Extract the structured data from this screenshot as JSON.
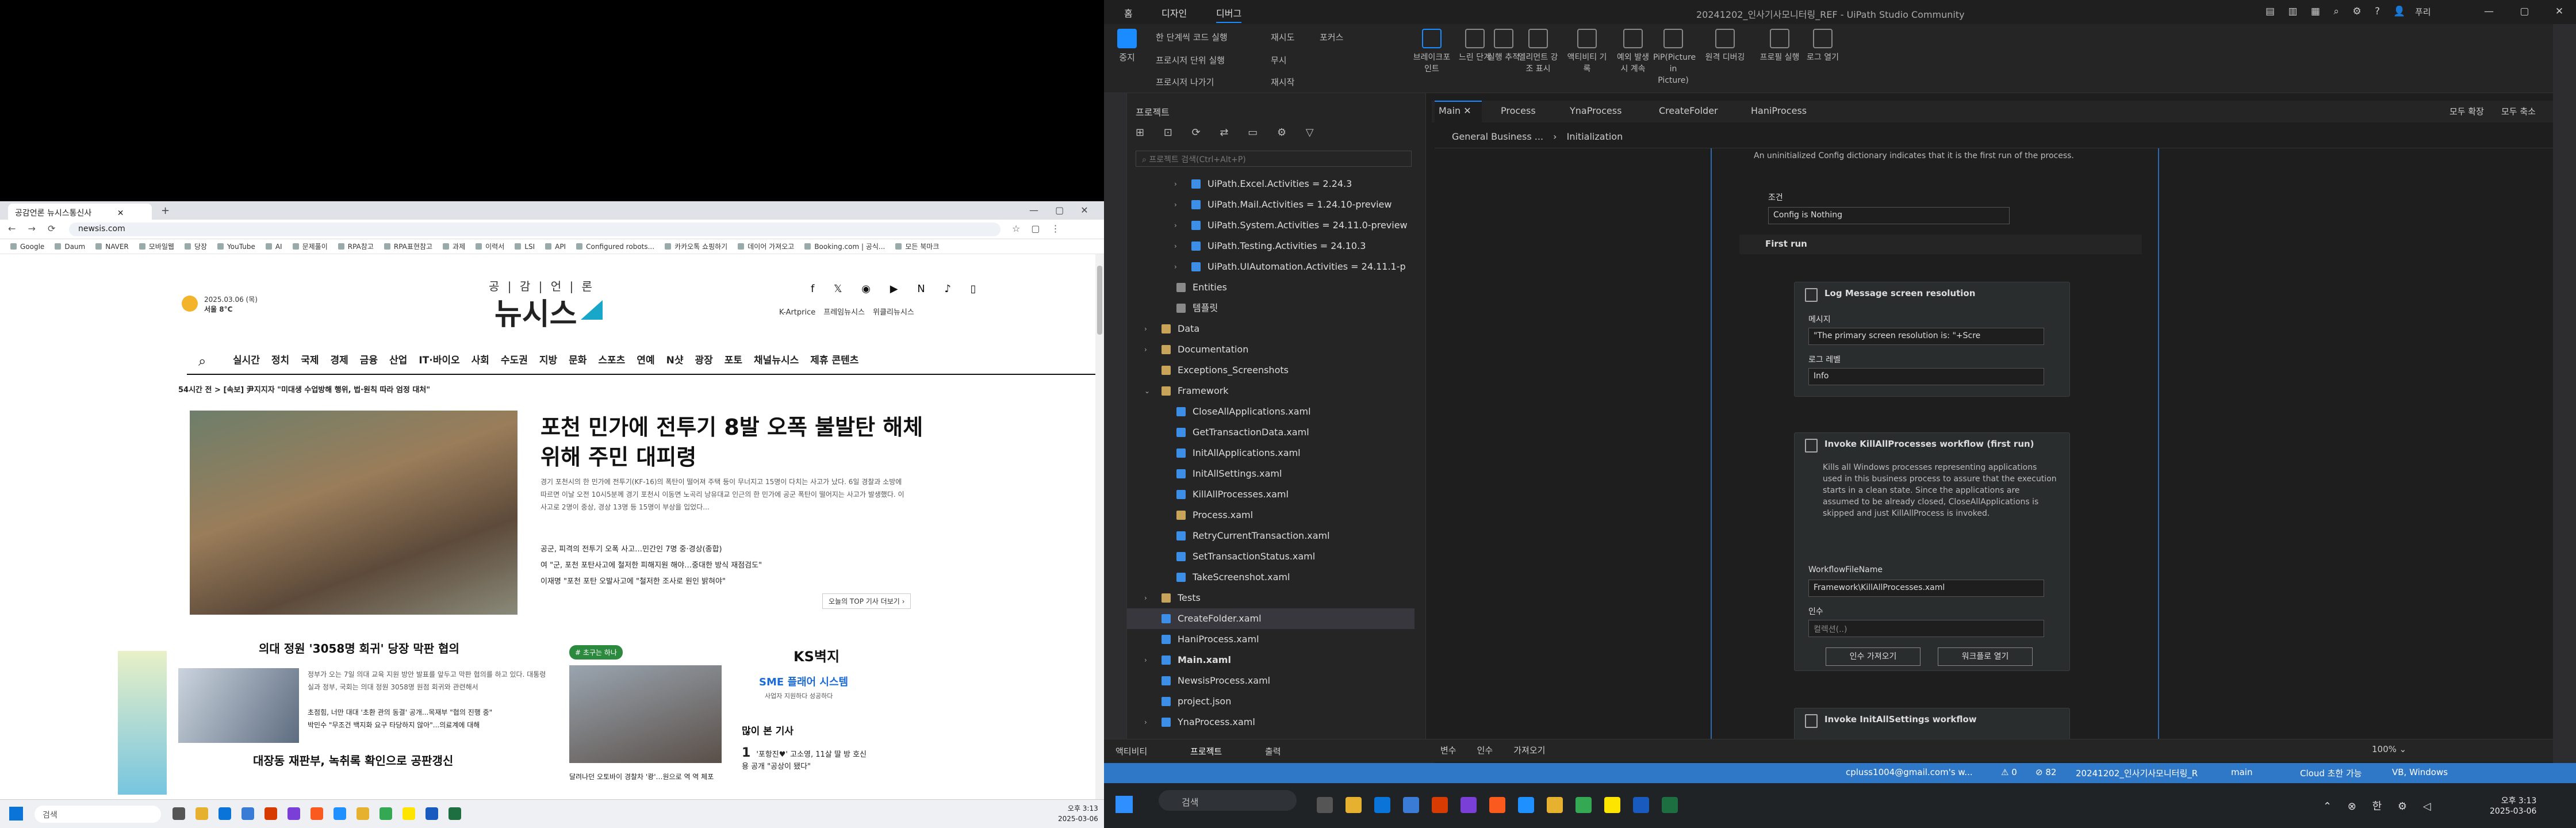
{
  "browser": {
    "tab_title": "공감언론 뉴시스통신사",
    "url": "newsis.com",
    "bookmarks": [
      "Google",
      "Daum",
      "NAVER",
      "모바일웹",
      "당장",
      "YouTube",
      "AI",
      "문제풀이",
      "RPA참고",
      "RPA표현참고",
      "과제",
      "이력서",
      "LSI",
      "API",
      "Configured robots...",
      "카카오톡 쇼핑하기",
      "데이어 가져오고",
      "Booking.com | 공식...",
      "모든 북마크"
    ],
    "site": {
      "logo_top": "공 | 감 | 언 | 론",
      "logo": "뉴시스",
      "weather_date": "2025.03.06 (목)",
      "weather_loc": "서울 8°C",
      "topnav": [
        "K-Artprice",
        "프레임뉴시스",
        "위클리뉴시스"
      ],
      "menu": [
        "실시간",
        "정치",
        "국제",
        "경제",
        "금융",
        "산업",
        "IT·바이오",
        "사회",
        "수도권",
        "지방",
        "문화",
        "스포츠",
        "연예",
        "N샷",
        "광장",
        "포토",
        "채널뉴시스",
        "제휴 콘텐츠"
      ],
      "ticker": "54시간 전 > [속보] 尹지지자 \"미대생 수업방해 행위, 법·원칙 따라 엄정 대처\"",
      "hero_title": "포천 민가에 전투기 8발 오폭 불발탄 해체 위해 주민 대피령",
      "hero_body": "경기 포천시의 한 민가에 전투기(KF-16)의 폭탄이 떨어져 주택 등이 무너지고 15명이 다치는 사고가 났다. 6일 경찰과 소방에 따르면 이날 오전 10시5분께 경기 포천시 이동면 노곡리 낭유대교 인근의 한 민가에 공군 폭탄이 떨어지는 사고가 발생했다. 이 사고로 2명이 중상, 경상 13명 등 15명이 부상을 입었다...",
      "hero_links": [
        "공군, 피격의 전투기 오폭 사고…민간인 7명 중·경상(종합)",
        "여 \"군, 포천 포탄사고에 철저한 피해지원 해야…중대한 방식 재점검도\"",
        "이재명 \"포천 포탄 오발사고에 \"철저한 조사로 원인 밝혀야\""
      ],
      "more": "오늘의 TOP 기사 더보기 ›",
      "sec1_title": "의대 정원 '3058명 회귀' 당장 막판 협의",
      "sec1_body": "정부가 오는 7일 의대 교육 지원 방안 발표를 앞두고 막판 협의를 하고 있다. 대통령실과 정부, 국회는 의대 정원 3058명 원점 회귀와 관련해서",
      "sec1_links": [
        "초점힘, 너만 대대 '초환 관의 동결' 공개...목재부 \"협의 진행 중\"",
        "박민수 \"무조건 백지화 요구 타당하지 않아\"...의료계에 대해"
      ],
      "sec2_title": "대장동 재판부, 녹취록 확인으로 공판갱신",
      "tag": "# 초구는 하나",
      "img3_caption": "달려나던 오토바이 경찰차 '쾅'…원으로 역 역 체포",
      "ks": "KS벽지",
      "ad": "SME 플래어 시스템",
      "ad_sub": "사업자 지원하다 성공하다",
      "popular": "많이 본 기사",
      "pop1_num": "1",
      "pop1": "'포항진♥' 고소영, 11살 딸 방 호신용 공개 \"공상이 됐다\""
    }
  },
  "taskbar_left": {
    "search": "검색",
    "time": "오후 3:13",
    "date": "2025-03-06"
  },
  "studio": {
    "title": "20241202_인사기사모니터링_REF - UiPath Studio Community",
    "ribbon_tabs": [
      "홈",
      "디자인",
      "디버그"
    ],
    "ribbon_stop": "중지",
    "ribbon_small": [
      [
        "한 단계씩 코드 실행",
        "재시도",
        "포커스"
      ],
      [
        "프로시저 단위 실행",
        "무시"
      ],
      [
        "프로시저 나가기",
        "재시작"
      ]
    ],
    "ribbon_big": [
      "브레이크포인트",
      "느린 단계",
      "실행 추적",
      "엘리먼트 강조 표시",
      "액티비티 기록",
      "예외 발생 시 계속",
      "PiP(Picture in Picture)",
      "원격 디버깅",
      "프로필 실행",
      "로그 열기"
    ],
    "project_header": "프로젝트",
    "project_search": "프로젝트 검색(Ctrl+Alt+P)",
    "tree": [
      {
        "label": "UiPath.Excel.Activities = 2.24.3",
        "indent": 2,
        "chev": "›",
        "color": "#3c8ee6"
      },
      {
        "label": "UiPath.Mail.Activities = 1.24.10-preview",
        "indent": 2,
        "chev": "›",
        "color": "#3c8ee6"
      },
      {
        "label": "UiPath.System.Activities = 24.11.0-preview",
        "indent": 2,
        "chev": "›",
        "color": "#3c8ee6"
      },
      {
        "label": "UiPath.Testing.Activities = 24.10.3",
        "indent": 2,
        "chev": "›",
        "color": "#3c8ee6"
      },
      {
        "label": "UiPath.UIAutomation.Activities = 24.11.1-p",
        "indent": 2,
        "chev": "›",
        "color": "#3c8ee6"
      },
      {
        "label": "Entities",
        "indent": 1,
        "chev": "",
        "color": "#8a8a8a"
      },
      {
        "label": "템플릿",
        "indent": 1,
        "chev": "",
        "color": "#8a8a8a"
      },
      {
        "label": "Data",
        "indent": 0,
        "chev": "›",
        "color": "#c8a45a"
      },
      {
        "label": "Documentation",
        "indent": 0,
        "chev": "›",
        "color": "#c8a45a"
      },
      {
        "label": "Exceptions_Screenshots",
        "indent": 0,
        "chev": "",
        "color": "#c8a45a"
      },
      {
        "label": "Framework",
        "indent": 0,
        "chev": "⌄",
        "color": "#c8a45a"
      },
      {
        "label": "CloseAllApplications.xaml",
        "indent": 1,
        "chev": "",
        "color": "#3c8ee6"
      },
      {
        "label": "GetTransactionData.xaml",
        "indent": 1,
        "chev": "",
        "color": "#3c8ee6"
      },
      {
        "label": "InitAllApplications.xaml",
        "indent": 1,
        "chev": "",
        "color": "#3c8ee6"
      },
      {
        "label": "InitAllSettings.xaml",
        "indent": 1,
        "chev": "",
        "color": "#3c8ee6"
      },
      {
        "label": "KillAllProcesses.xaml",
        "indent": 1,
        "chev": "",
        "color": "#3c8ee6"
      },
      {
        "label": "Process.xaml",
        "indent": 1,
        "chev": "",
        "color": "#c8a45a"
      },
      {
        "label": "RetryCurrentTransaction.xaml",
        "indent": 1,
        "chev": "",
        "color": "#3c8ee6"
      },
      {
        "label": "SetTransactionStatus.xaml",
        "indent": 1,
        "chev": "",
        "color": "#3c8ee6"
      },
      {
        "label": "TakeScreenshot.xaml",
        "indent": 1,
        "chev": "",
        "color": "#3c8ee6"
      },
      {
        "label": "Tests",
        "indent": 0,
        "chev": "›",
        "color": "#c8a45a"
      },
      {
        "label": "CreateFolder.xaml",
        "indent": 0,
        "chev": "",
        "color": "#3c8ee6",
        "selected": true
      },
      {
        "label": "HaniProcess.xaml",
        "indent": 0,
        "chev": "",
        "color": "#3c8ee6"
      },
      {
        "label": "Main.xaml",
        "indent": 0,
        "chev": "›",
        "color": "#3c8ee6",
        "bold": true
      },
      {
        "label": "NewsisProcess.xaml",
        "indent": 0,
        "chev": "",
        "color": "#3c8ee6"
      },
      {
        "label": "project.json",
        "indent": 0,
        "chev": "",
        "color": "#3c8ee6"
      },
      {
        "label": "YnaProcess.xaml",
        "indent": 0,
        "chev": "›",
        "color": "#3c8ee6"
      }
    ],
    "doc_tabs": [
      "Main",
      "Process",
      "YnaProcess",
      "CreateFolder",
      "HaniProcess"
    ],
    "expand_all": "모두 확장",
    "collapse_all": "모두 축소",
    "breadcrumb": [
      "General Business ...",
      "Initialization"
    ],
    "canvas": {
      "note": "An uninitialized Config dictionary indicates that it is the first run of the process.",
      "condition_label": "조건",
      "condition_value": "Config is Nothing",
      "first_run": "First run",
      "log_title": "Log Message screen resolution",
      "log_msg_label": "메시지",
      "log_msg_value": "\"The primary screen resolution is: \"+Scre",
      "log_level_label": "로그 레벨",
      "log_level_value": "Info",
      "invoke1_title": "Invoke KillAllProcesses workflow (first run)",
      "invoke1_desc": "Kills all Windows processes representing applications used in this business process to assure that the execution starts in a clean state. Since the applications are assumed to be already closed, CloseAllApplications is skipped and just KillAllProcess is invoked.",
      "wf_label": "WorkflowFileName",
      "wf_value": "Framework\\KillAllProcesses.xaml",
      "args_label": "인수",
      "args_placeholder": "컬렉션(..)",
      "btn_import": "인수 가져오기",
      "btn_open": "워크플로 열기",
      "invoke2_title": "Invoke InitAllSettings workflow"
    },
    "bottom_left": [
      "액티비티",
      "프로젝트",
      "출력"
    ],
    "bottom_tabs": [
      "변수",
      "인수",
      "가져오기"
    ],
    "zoom": "100%",
    "status": {
      "user": "cpluss1004@gmail.com's w...",
      "errors": "0",
      "warnings": "82",
      "project": "20241202_인사기사모니터링_R",
      "branch": "main",
      "cloud": "Cloud 초한 가능",
      "lang": "VB, Windows"
    }
  },
  "taskbar_right": {
    "search": "검색",
    "time": "오후 3:13",
    "date": "2025-03-06"
  }
}
